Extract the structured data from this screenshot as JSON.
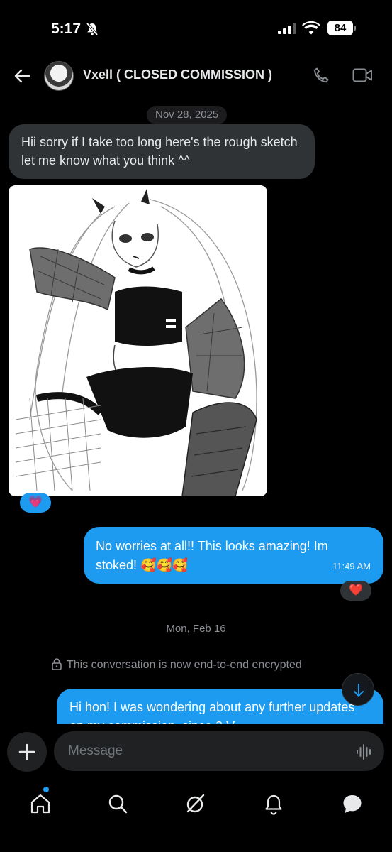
{
  "status_bar": {
    "time": "5:17",
    "battery": "84",
    "icons": [
      "bell-off-icon",
      "signal-icon",
      "wifi-icon",
      "battery-icon"
    ]
  },
  "header": {
    "contact_name": "Vxell ( CLOSED COMMISSION )",
    "icons": [
      "back-arrow-icon",
      "phone-icon",
      "video-icon"
    ]
  },
  "chat": {
    "date_1": "Nov 28, 2025",
    "incoming_message": "Hii sorry if I take too long here's the rough sketch let me know what you think ^^",
    "image_reaction": "💗",
    "outgoing_message_1": "No worries at all!! This looks amazing! Im stoked! 🥰🥰🥰",
    "outgoing_time_1": "11:49 AM",
    "outgoing_reaction_1": "❤️",
    "date_2": "Mon, Feb 16",
    "encryption_note": "This conversation is now end-to-end encrypted",
    "outgoing_message_2": "Hi hon! I was wondering about any further updates on my commission, since 2 V"
  },
  "composer": {
    "placeholder": "Message"
  },
  "nav": {
    "items": [
      "home-icon",
      "search-icon",
      "grok-icon",
      "notifications-icon",
      "messages-icon"
    ]
  },
  "colors": {
    "background": "#000000",
    "accent": "#1d9bf0",
    "incoming_bubble": "#2f3336",
    "secondary_text": "#8b8f94"
  }
}
